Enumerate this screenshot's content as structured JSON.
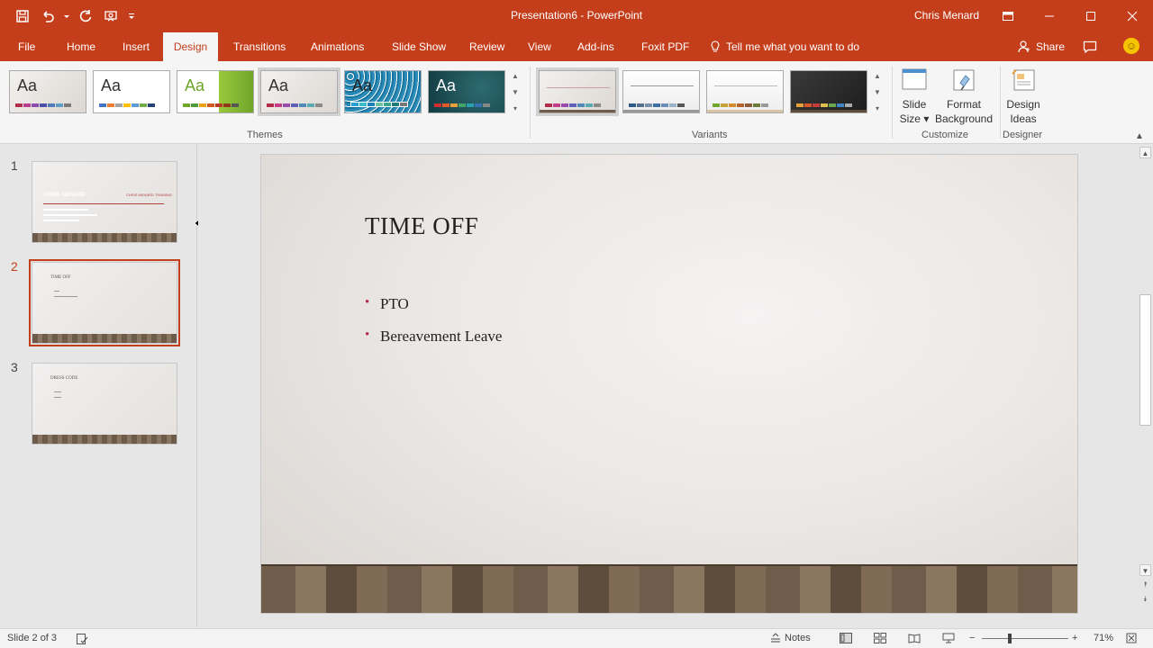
{
  "titlebar": {
    "doc_title": "Presentation6  -  PowerPoint",
    "user_name": "Chris Menard"
  },
  "tabs": [
    {
      "label": "File"
    },
    {
      "label": "Home"
    },
    {
      "label": "Insert"
    },
    {
      "label": "Design"
    },
    {
      "label": "Transitions"
    },
    {
      "label": "Animations"
    },
    {
      "label": "Slide Show"
    },
    {
      "label": "Review"
    },
    {
      "label": "View"
    },
    {
      "label": "Add-ins"
    },
    {
      "label": "Foxit PDF"
    }
  ],
  "active_tab": "Design",
  "tellme": "Tell me what you want to do",
  "share": "Share",
  "ribbon": {
    "themes_label": "Themes",
    "variants_label": "Variants",
    "customize_label": "Customize",
    "designer_label": "Designer",
    "theme_aa": "Aa",
    "slide_size_line1": "Slide",
    "slide_size_line2": "Size",
    "format_bg_line1": "Format",
    "format_bg_line2": "Background",
    "design_ideas_line1": "Design",
    "design_ideas_line2": "Ideas"
  },
  "colors": {
    "accent": "#c43e1c",
    "bullet": "#b32d4b"
  },
  "slides_panel": {
    "numbers": [
      "1",
      "2",
      "3"
    ],
    "thumb1_title": "CHRIS MENARD",
    "thumb1_brand": "CHRIS MENARD TRAINING",
    "thumb2_title": "TIME OFF",
    "thumb3_title": "DRESS CODE"
  },
  "slide": {
    "title": "TIME OFF",
    "bullets": [
      "PTO",
      "Bereavement Leave"
    ]
  },
  "statusbar": {
    "slide_info": "Slide 2 of 3",
    "notes": "Notes",
    "zoom": "71%",
    "zoom_minus": "−",
    "zoom_plus": "+"
  }
}
